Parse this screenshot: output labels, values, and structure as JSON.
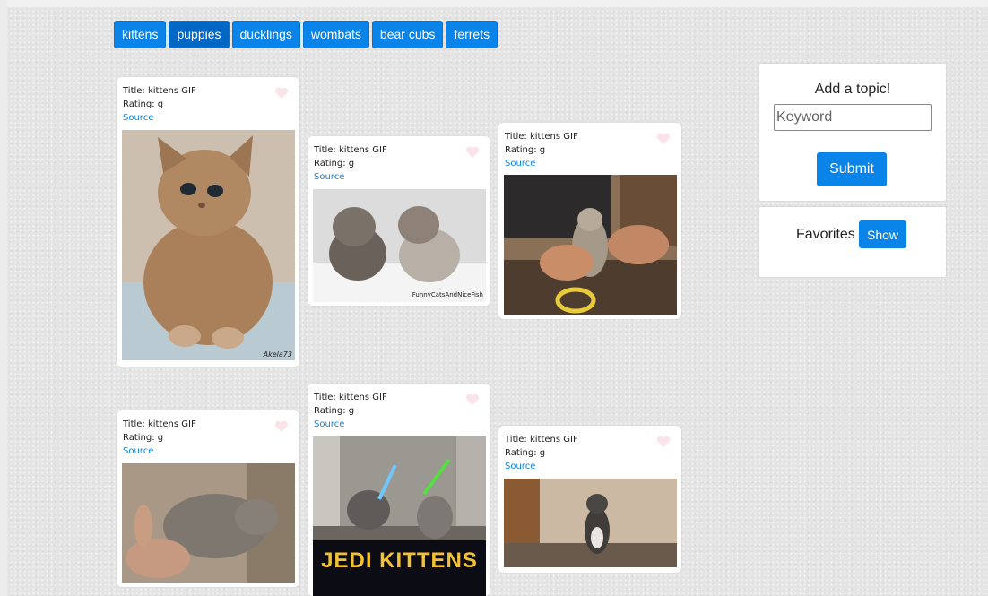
{
  "topics": [
    "kittens",
    "puppies",
    "ducklings",
    "wombats",
    "bear cubs",
    "ferrets"
  ],
  "active_topic_index": 1,
  "cards": [
    {
      "title": "Title: kittens GIF",
      "rating": "Rating: g",
      "source": "Source",
      "image": "fluffy-kitten-looking-up",
      "watermark": "Akela73"
    },
    {
      "title": "Title: kittens GIF",
      "rating": "Rating: g",
      "source": "Source",
      "image": "two-kittens-facing",
      "watermark": "FunnyCatsAndNiceFish"
    },
    {
      "title": "Title: kittens GIF",
      "rating": "Rating: g",
      "source": "Source",
      "image": "kitten-held-by-hands",
      "watermark": ""
    },
    {
      "title": "Title: kittens GIF",
      "rating": "Rating: g",
      "source": "Source",
      "image": "sleepy-gray-kitten",
      "watermark": ""
    },
    {
      "title": "Title: kittens GIF",
      "rating": "Rating: g",
      "source": "Source",
      "image": "jedi-kittens-lightsabers",
      "watermark": "JEDI KITTENS"
    },
    {
      "title": "Title: kittens GIF",
      "rating": "Rating: g",
      "source": "Source",
      "image": "kitten-standing-up",
      "watermark": ""
    }
  ],
  "add_topic": {
    "heading": "Add a topic!",
    "placeholder": "Keyword",
    "submit_label": "Submit"
  },
  "favorites": {
    "label": "Favorites",
    "show_label": "Show"
  },
  "colors": {
    "accent": "#0a84e8",
    "heart": "#fbe3ea"
  },
  "icons": {
    "favorite": "heart-icon"
  }
}
